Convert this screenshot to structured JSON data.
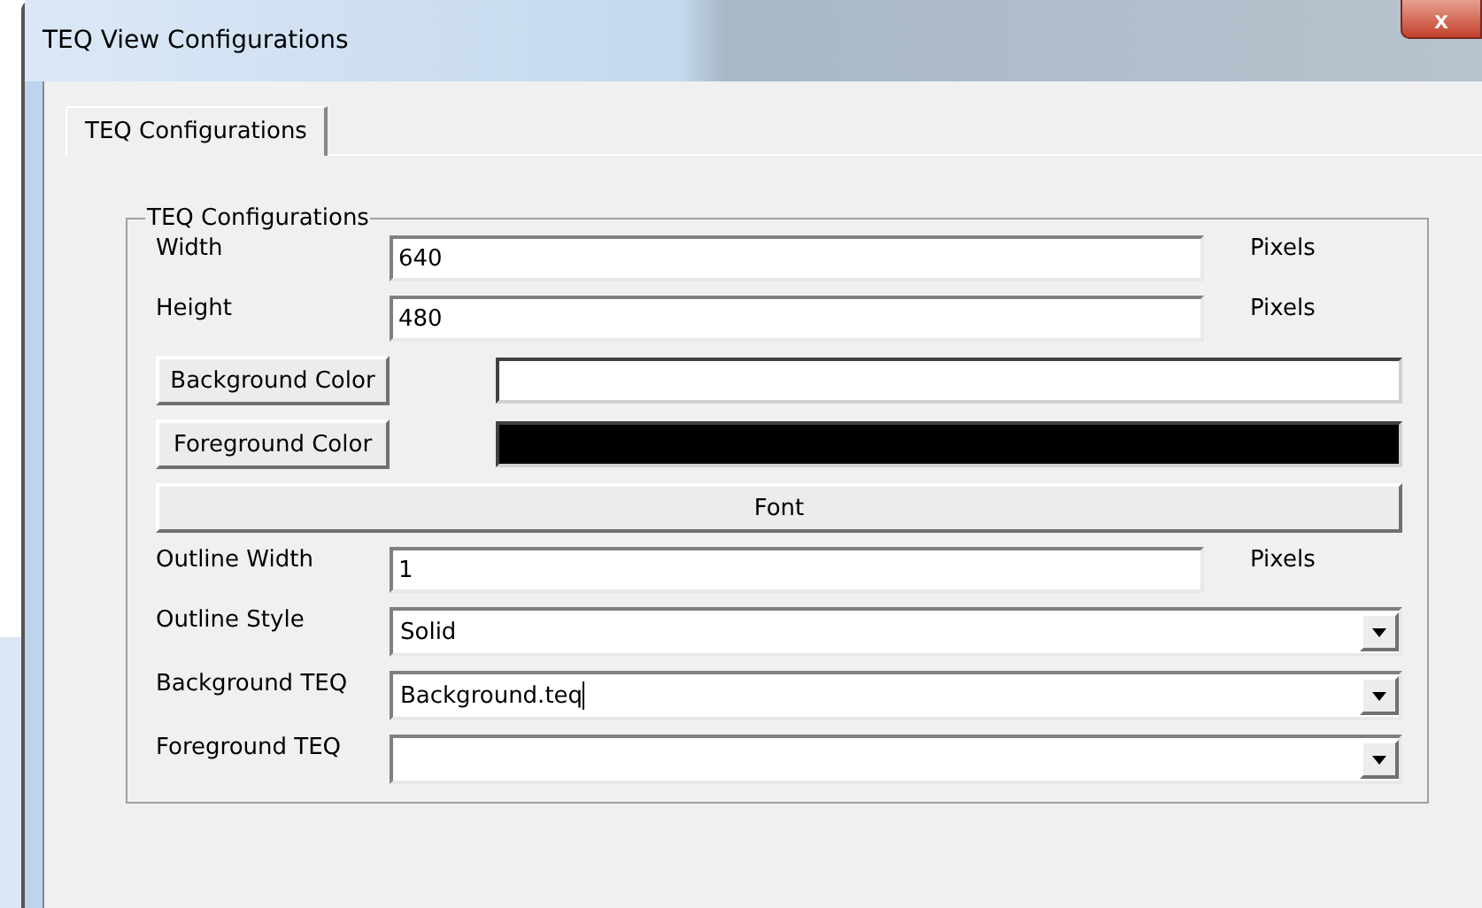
{
  "window": {
    "title": "TEQ View Configurations",
    "close": "x"
  },
  "tabs": [
    {
      "label": "TEQ Configurations",
      "selected": true
    }
  ],
  "group": {
    "title": "TEQ Configurations"
  },
  "rows": [
    {
      "kind": "text",
      "label": "Width",
      "value": "640",
      "unit": "Pixels"
    },
    {
      "kind": "text",
      "label": "Height",
      "value": "480",
      "unit": "Pixels"
    },
    {
      "kind": "color",
      "label": "Background Color",
      "color": "#ffffff"
    },
    {
      "kind": "color",
      "label": "Foreground Color",
      "color": "#000000"
    },
    {
      "kind": "button",
      "label": "Font"
    },
    {
      "kind": "text",
      "label": "Outline Width",
      "value": "1",
      "unit": "Pixels"
    },
    {
      "kind": "combo",
      "label": "Outline Style",
      "value": "Solid",
      "caret": false
    },
    {
      "kind": "combo",
      "label": "Background TEQ",
      "value": "Background.teq",
      "caret": true
    },
    {
      "kind": "combo",
      "label": "Foreground TEQ",
      "caret": false
    }
  ]
}
